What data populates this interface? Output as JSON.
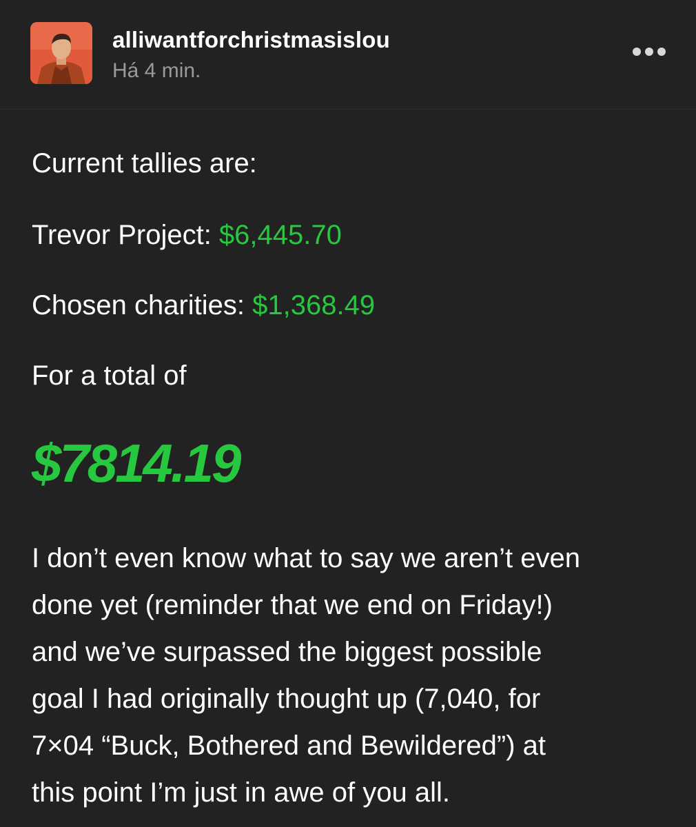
{
  "post": {
    "username": "alliwantforchristmasislou",
    "timestamp": "Há 4 min.",
    "intro": "Current tallies are:",
    "trevor_label": "Trevor Project: ",
    "trevor_amount": "$6,445.70",
    "chosen_label": "Chosen charities: ",
    "chosen_amount": "$1,368.49",
    "total_intro": "For a total of",
    "total_amount": "$7814.19",
    "paragraph_lines": [
      "I don’t even know what to say we aren’t even",
      "done yet (reminder that we end on Friday!)",
      "and we’ve surpassed the biggest possible",
      "goal I had originally thought up (7,040, for",
      "7×04 “Buck, Bothered and Bewildered”) at",
      "this point I’m just in awe of you all."
    ]
  },
  "colors": {
    "background": "#222222",
    "accent_green": "#27c840",
    "muted_text": "#9a9a9a"
  },
  "icons": {
    "more": "more-dots-icon",
    "avatar": "avatar"
  }
}
